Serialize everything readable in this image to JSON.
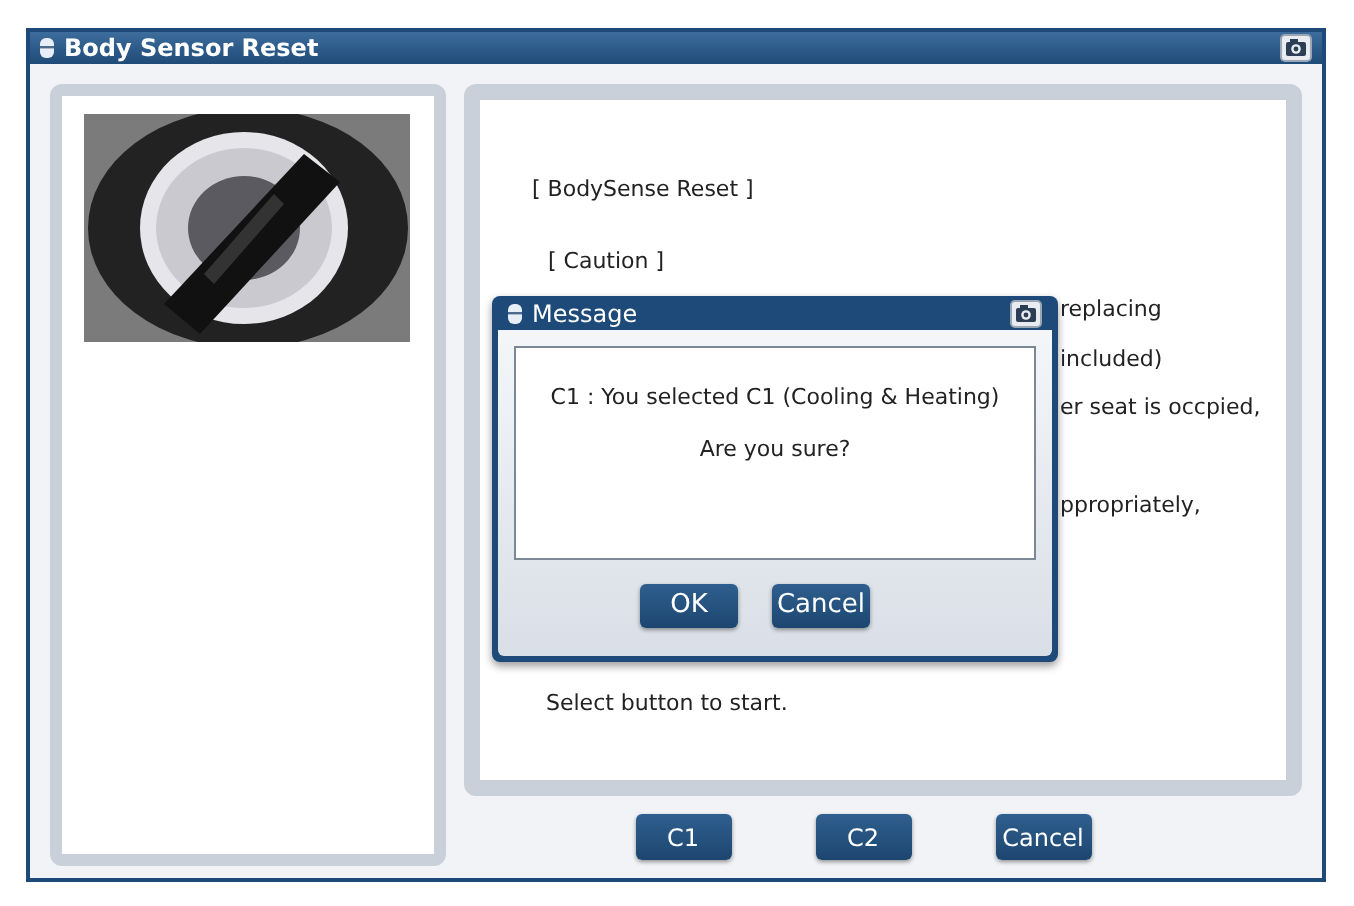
{
  "window": {
    "title": "Body Sensor Reset"
  },
  "content": {
    "heading": "[ BodySense Reset ]",
    "caution": "[ Caution ]",
    "fragments": [
      "replacing",
      "included)",
      "er seat is occpied,",
      "ppropriately,"
    ],
    "footer": "Select button to start."
  },
  "buttons": [
    "C1",
    "C2",
    "Cancel"
  ],
  "dialog": {
    "title": "Message",
    "lines": [
      "C1 : You selected C1 (Cooling & Heating)",
      "Are you sure?"
    ],
    "buttons": [
      "OK",
      "Cancel"
    ]
  }
}
